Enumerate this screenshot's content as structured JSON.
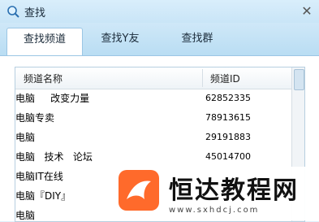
{
  "window": {
    "title": "查找"
  },
  "tabs": [
    {
      "label": "查找频道",
      "active": true
    },
    {
      "label": "查找Y友",
      "active": false
    },
    {
      "label": "查找群",
      "active": false
    }
  ],
  "table": {
    "columns": [
      "频道名称",
      "频道ID"
    ],
    "rows": [
      {
        "name": "电脑     改变力量",
        "id": "62852335"
      },
      {
        "name": "电脑专卖",
        "id": "78913615"
      },
      {
        "name": "电脑",
        "id": "29191883"
      },
      {
        "name": "电脑   技术   论坛",
        "id": "45014700"
      },
      {
        "name": "电脑IT在线",
        "id": ""
      },
      {
        "name": "电脑『DIY』",
        "id": ""
      },
      {
        "name": "电脑",
        "id": ""
      }
    ]
  },
  "watermark": {
    "name": "恒达教程网",
    "url": "www.sxhdcj.com"
  },
  "colors": {
    "accent": "#ff6a2b",
    "titlebar": "#c9e5f7",
    "header_border": "#9bc6e4"
  }
}
